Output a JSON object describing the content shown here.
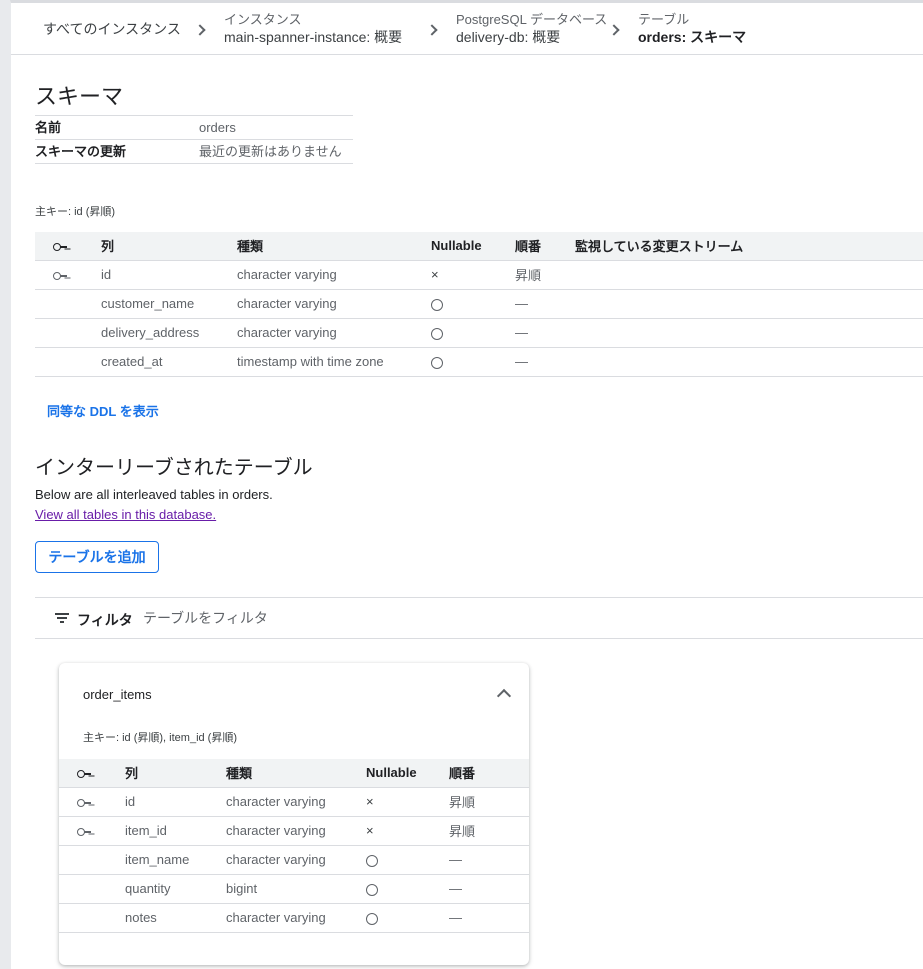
{
  "breadcrumb": {
    "root": "すべてのインスタンス",
    "instance_small": "インスタンス",
    "instance": "main-spanner-instance: 概要",
    "db_small": "PostgreSQL データベース",
    "db": "delivery-db: 概要",
    "table_small": "テーブル",
    "table": "orders: スキーマ"
  },
  "schema": {
    "title": "スキーマ",
    "name_label": "名前",
    "name_value": "orders",
    "update_label": "スキーマの更新",
    "update_value": "最近の更新はありません",
    "primary_key": "主キー: id (昇順)"
  },
  "columns_header": {
    "col": "列",
    "type": "種類",
    "nullable": "Nullable",
    "order": "順番",
    "streams": "監視している変更ストリーム"
  },
  "columns": [
    {
      "name": "id",
      "type": "character varying",
      "nullable": "×",
      "order": "昇順"
    },
    {
      "name": "customer_name",
      "type": "character varying",
      "nullable": "",
      "order": "—"
    },
    {
      "name": "delivery_address",
      "type": "character varying",
      "nullable": "",
      "order": "—"
    },
    {
      "name": "created_at",
      "type": "timestamp with time zone",
      "nullable": "",
      "order": "—"
    }
  ],
  "ddl_link": "同等な DDL を表示",
  "interleaved": {
    "title": "インターリーブされたテーブル",
    "description": "Below are all interleaved tables in orders.",
    "link": "View all tables in this database.",
    "add_button": "テーブルを追加",
    "filter_label": "フィルタ",
    "filter_placeholder": "テーブルをフィルタ"
  },
  "child_table": {
    "name": "order_items",
    "primary_key": "主キー: id (昇順), item_id (昇順)",
    "columns": [
      {
        "name": "id",
        "type": "character varying",
        "nullable": "×",
        "order": "昇順"
      },
      {
        "name": "item_id",
        "type": "character varying",
        "nullable": "×",
        "order": "昇順"
      },
      {
        "name": "item_name",
        "type": "character varying",
        "nullable": "",
        "order": "—"
      },
      {
        "name": "quantity",
        "type": "bigint",
        "nullable": "",
        "order": "—"
      },
      {
        "name": "notes",
        "type": "character varying",
        "nullable": "",
        "order": "—"
      }
    ]
  },
  "colors": {
    "link": "#1a73e8",
    "visited": "#681da8",
    "header_bg": "#f1f3f4"
  }
}
